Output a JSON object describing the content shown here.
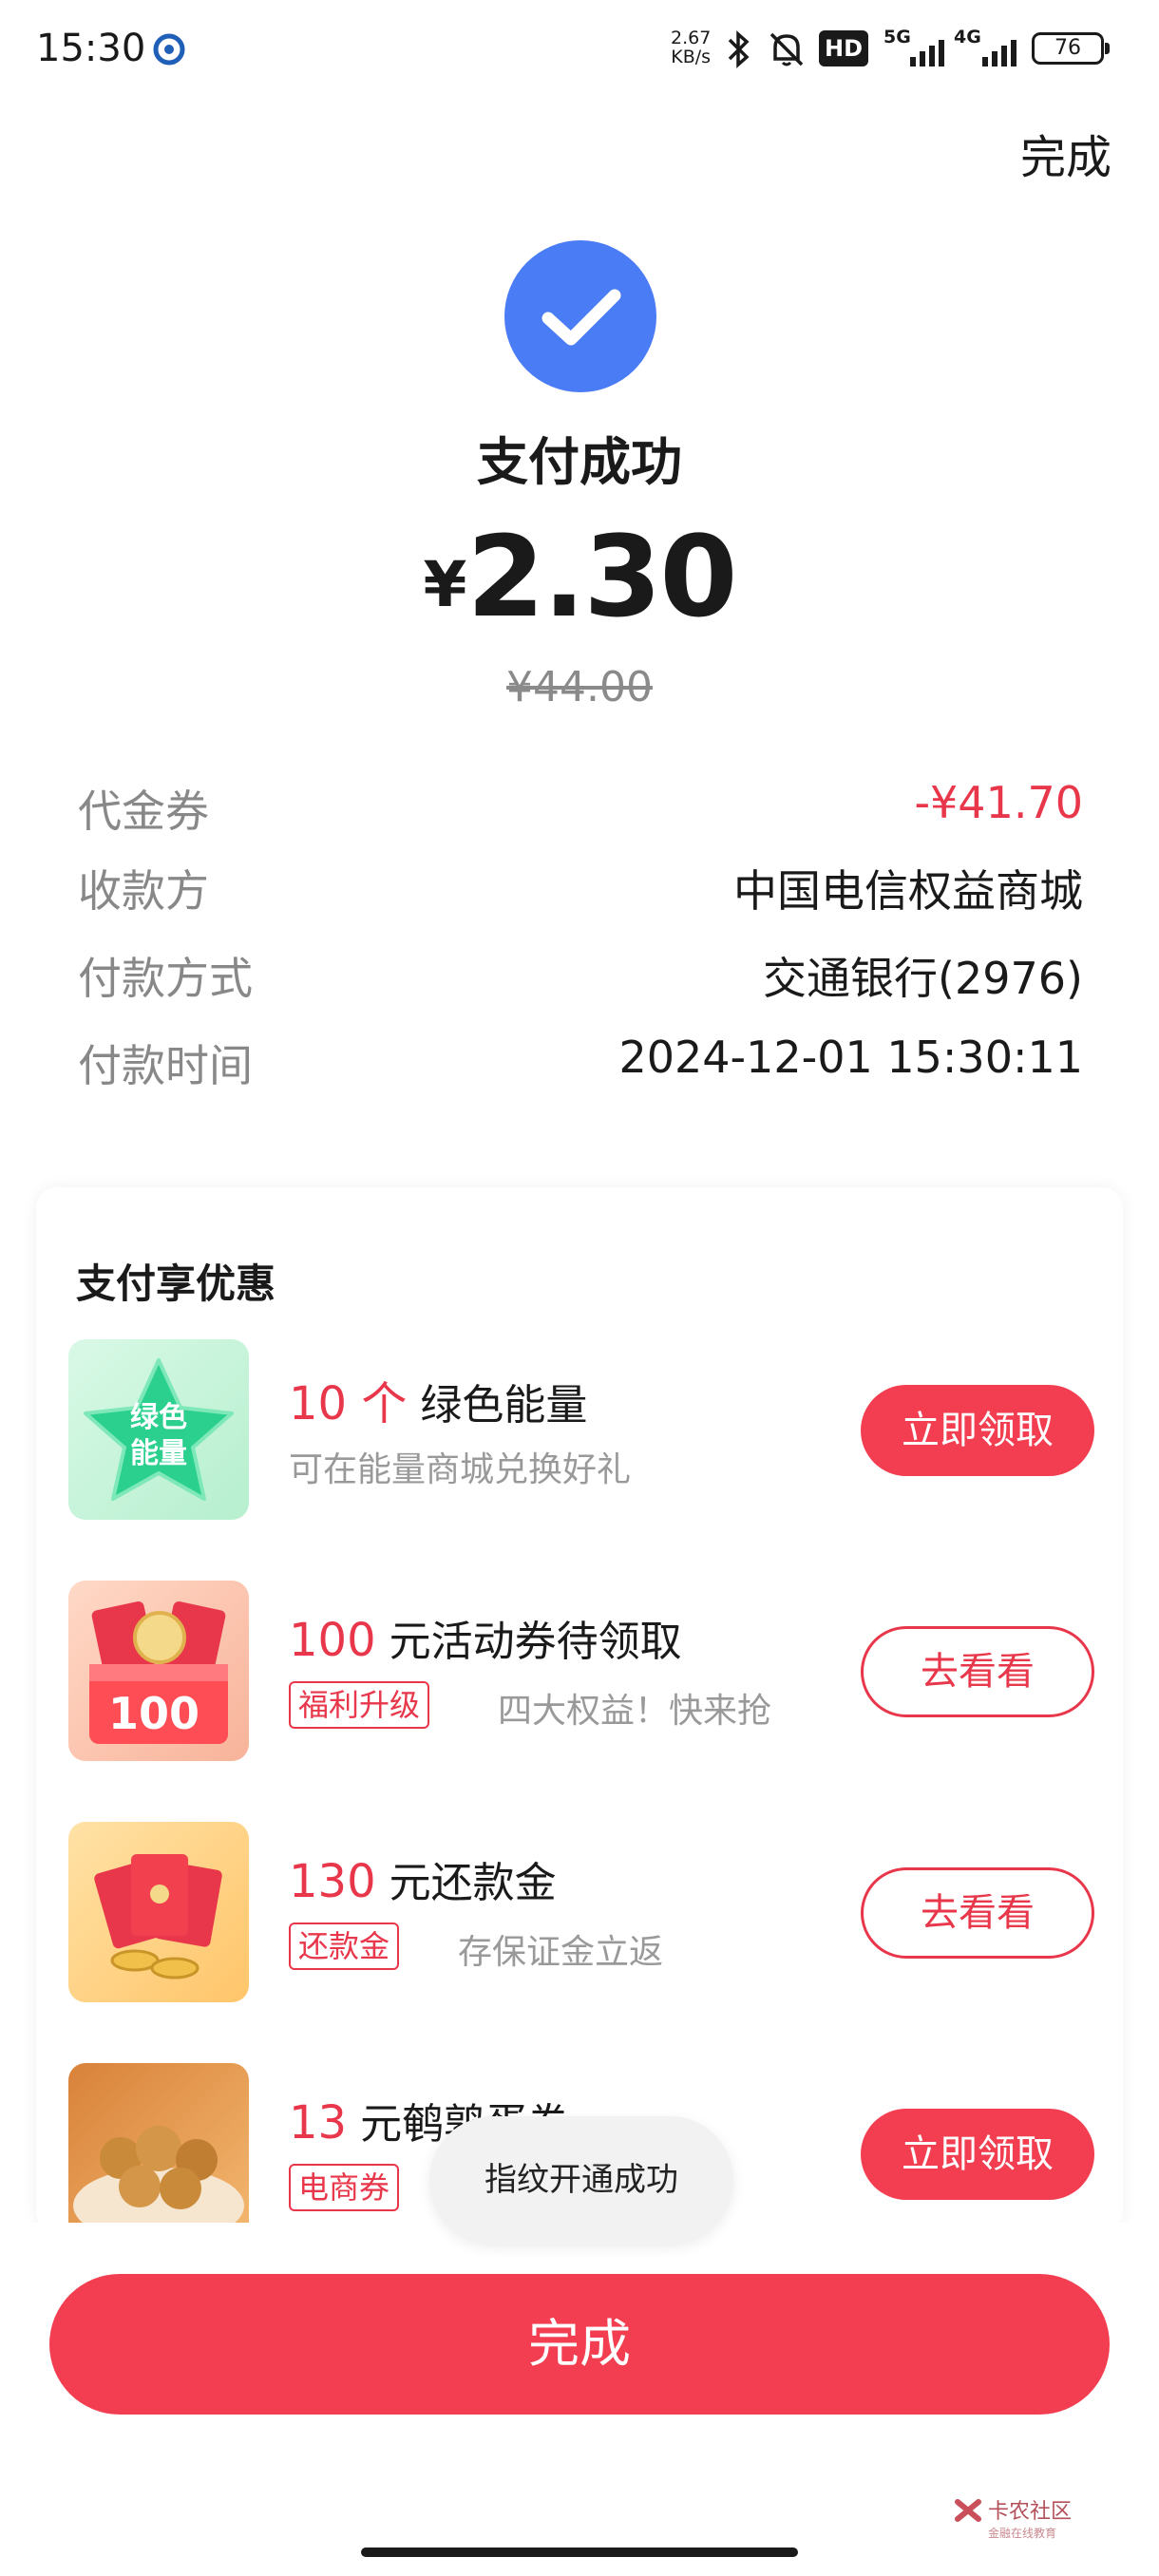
{
  "status_bar": {
    "time": "15:30",
    "speed_value": "2.67",
    "speed_unit": "KB/s",
    "hd_label": "HD",
    "net1": "5G",
    "net2": "4G",
    "battery": "76"
  },
  "header": {
    "done_label": "完成"
  },
  "result": {
    "title": "支付成功",
    "currency": "¥",
    "amount": "2.30",
    "original_price": "¥44.00"
  },
  "details": [
    {
      "label": "代金券",
      "value": "-¥41.70"
    },
    {
      "label": "收款方",
      "value": "中国电信权益商城"
    },
    {
      "label": "付款方式",
      "value": "交通银行(2976)"
    },
    {
      "label": "付款时间",
      "value": "2024-12-01 15:30:11"
    }
  ],
  "promo": {
    "title": "支付享优惠",
    "thumb1_text": "绿色能量",
    "thumb2_text": "100",
    "offers": [
      {
        "highlight": "10 个",
        "title": " 绿色能量",
        "subtitle": "可在能量商城兑换好礼",
        "tag": "",
        "tag_desc": "",
        "button": "立即领取"
      },
      {
        "highlight": "100",
        "title": " 元活动券待领取",
        "subtitle": "",
        "tag": "福利升级",
        "tag_desc": "四大权益！快来抢",
        "button": "去看看"
      },
      {
        "highlight": "130",
        "title": " 元还款金",
        "subtitle": "",
        "tag": "还款金",
        "tag_desc": "存保证金立返",
        "button": "去看看"
      },
      {
        "highlight": "13",
        "title": " 元鹌鹑蛋券",
        "subtitle": "",
        "tag": "电商券",
        "tag_desc": "",
        "button": "立即领取"
      }
    ]
  },
  "toast": "指纹开通成功",
  "bottom": {
    "done_label": "完成"
  },
  "watermark": {
    "title": "卡农社区",
    "subtitle": "金融在线教育"
  },
  "colors": {
    "accent_red": "#f23e50",
    "check_blue": "#4a7cf5"
  }
}
